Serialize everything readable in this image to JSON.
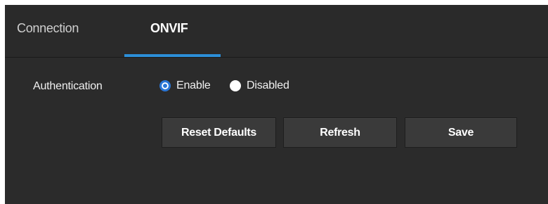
{
  "tabs": [
    {
      "label": "Connection",
      "active": false
    },
    {
      "label": "ONVIF",
      "active": true
    }
  ],
  "accent_color": "#2c8fd8",
  "authentication": {
    "label": "Authentication",
    "options": [
      {
        "label": "Enable",
        "selected": true
      },
      {
        "label": "Disabled",
        "selected": false
      }
    ]
  },
  "buttons": {
    "reset_defaults": "Reset Defaults",
    "refresh": "Refresh",
    "save": "Save"
  }
}
